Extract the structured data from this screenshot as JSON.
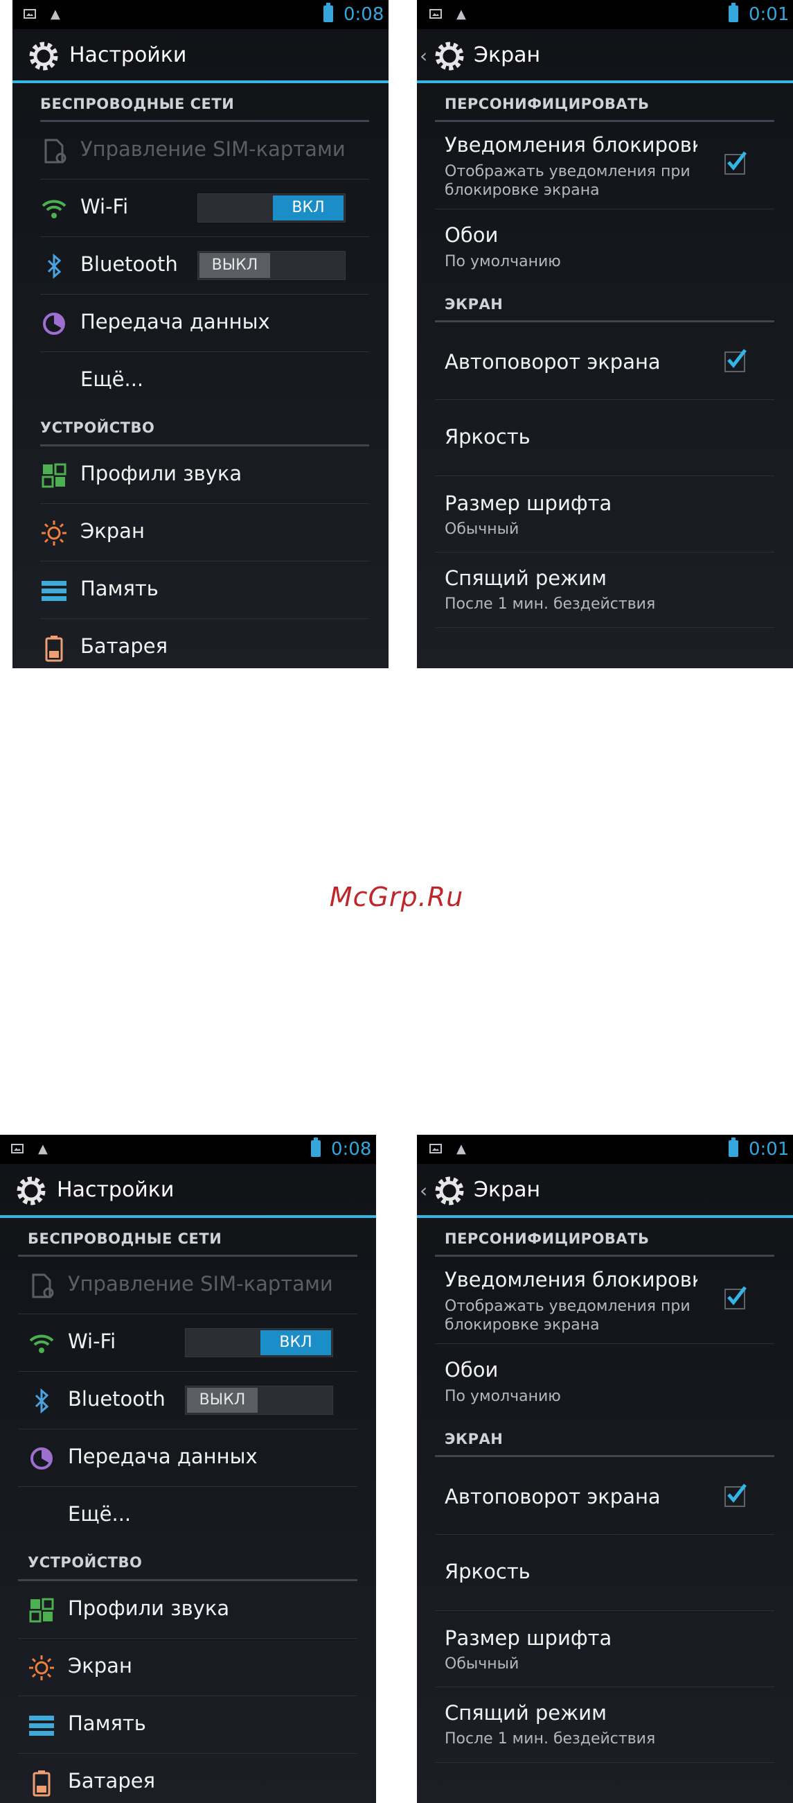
{
  "status": {
    "time_left": "0:08",
    "time_right": "0:01"
  },
  "settings": {
    "title": "Настройки",
    "section_wireless": "БЕСПРОВОДНЫЕ СЕТИ",
    "sim": "Управление SIM-картами",
    "wifi": "Wi-Fi",
    "wifi_state": "ВКЛ",
    "bluetooth": "Bluetooth",
    "bluetooth_state": "ВЫКЛ",
    "data": "Передача данных",
    "more": "Ещё...",
    "section_device": "УСТРОЙСТВО",
    "sound": "Профили звука",
    "display": "Экран",
    "memory": "Память",
    "battery": "Батарея"
  },
  "screen": {
    "title": "Экран",
    "section_personalize": "ПЕРСОНИФИЦИРОВАТЬ",
    "lock_notif": "Уведомления блокировки",
    "lock_notif_sub1": "Отображать уведомления при",
    "lock_notif_sub2": "блокировке экрана",
    "wallpaper": "Обои",
    "wallpaper_sub": "По умолчанию",
    "section_screen": "ЭКРАН",
    "autorotate": "Автоповорот экрана",
    "brightness": "Яркость",
    "fontsize": "Размер шрифта",
    "fontsize_sub": "Обычный",
    "sleep": "Спящий режим",
    "sleep_sub": "После 1 мин. бездействия"
  },
  "watermark": "McGrp.Ru",
  "colors": {
    "accent": "#33b5e5",
    "toggle_on": "#1b8ec8",
    "watermark": "#c0252a"
  }
}
